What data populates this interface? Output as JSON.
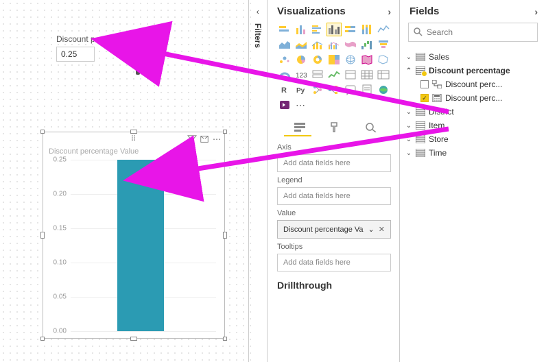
{
  "slicer": {
    "label": "Discount percentage",
    "value": "0.25"
  },
  "visual": {
    "title": "Discount percentage Value"
  },
  "chart_data": {
    "type": "bar",
    "categories": [
      ""
    ],
    "values": [
      0.25
    ],
    "title": "Discount percentage Value",
    "xlabel": "",
    "ylabel": "",
    "ylim": [
      0.0,
      0.25
    ],
    "yticks": [
      0.0,
      0.05,
      0.1,
      0.15,
      0.2,
      0.25
    ]
  },
  "filters_tab": {
    "label": "Filters"
  },
  "visualizations": {
    "header": "Visualizations",
    "wells": {
      "axis": {
        "label": "Axis",
        "placeholder": "Add data fields here"
      },
      "legend": {
        "label": "Legend",
        "placeholder": "Add data fields here"
      },
      "value": {
        "label": "Value",
        "chip": "Discount percentage Va"
      },
      "tooltips": {
        "label": "Tooltips",
        "placeholder": "Add data fields here"
      }
    },
    "drillthrough": "Drillthrough"
  },
  "fields": {
    "header": "Fields",
    "search_placeholder": "Search",
    "tables": {
      "sales": "Sales",
      "discount": "Discount percentage",
      "discount_children": {
        "perc": "Discount perc...",
        "value": "Discount perc..."
      },
      "district": "District",
      "item": "Item",
      "store": "Store",
      "time": "Time"
    }
  }
}
